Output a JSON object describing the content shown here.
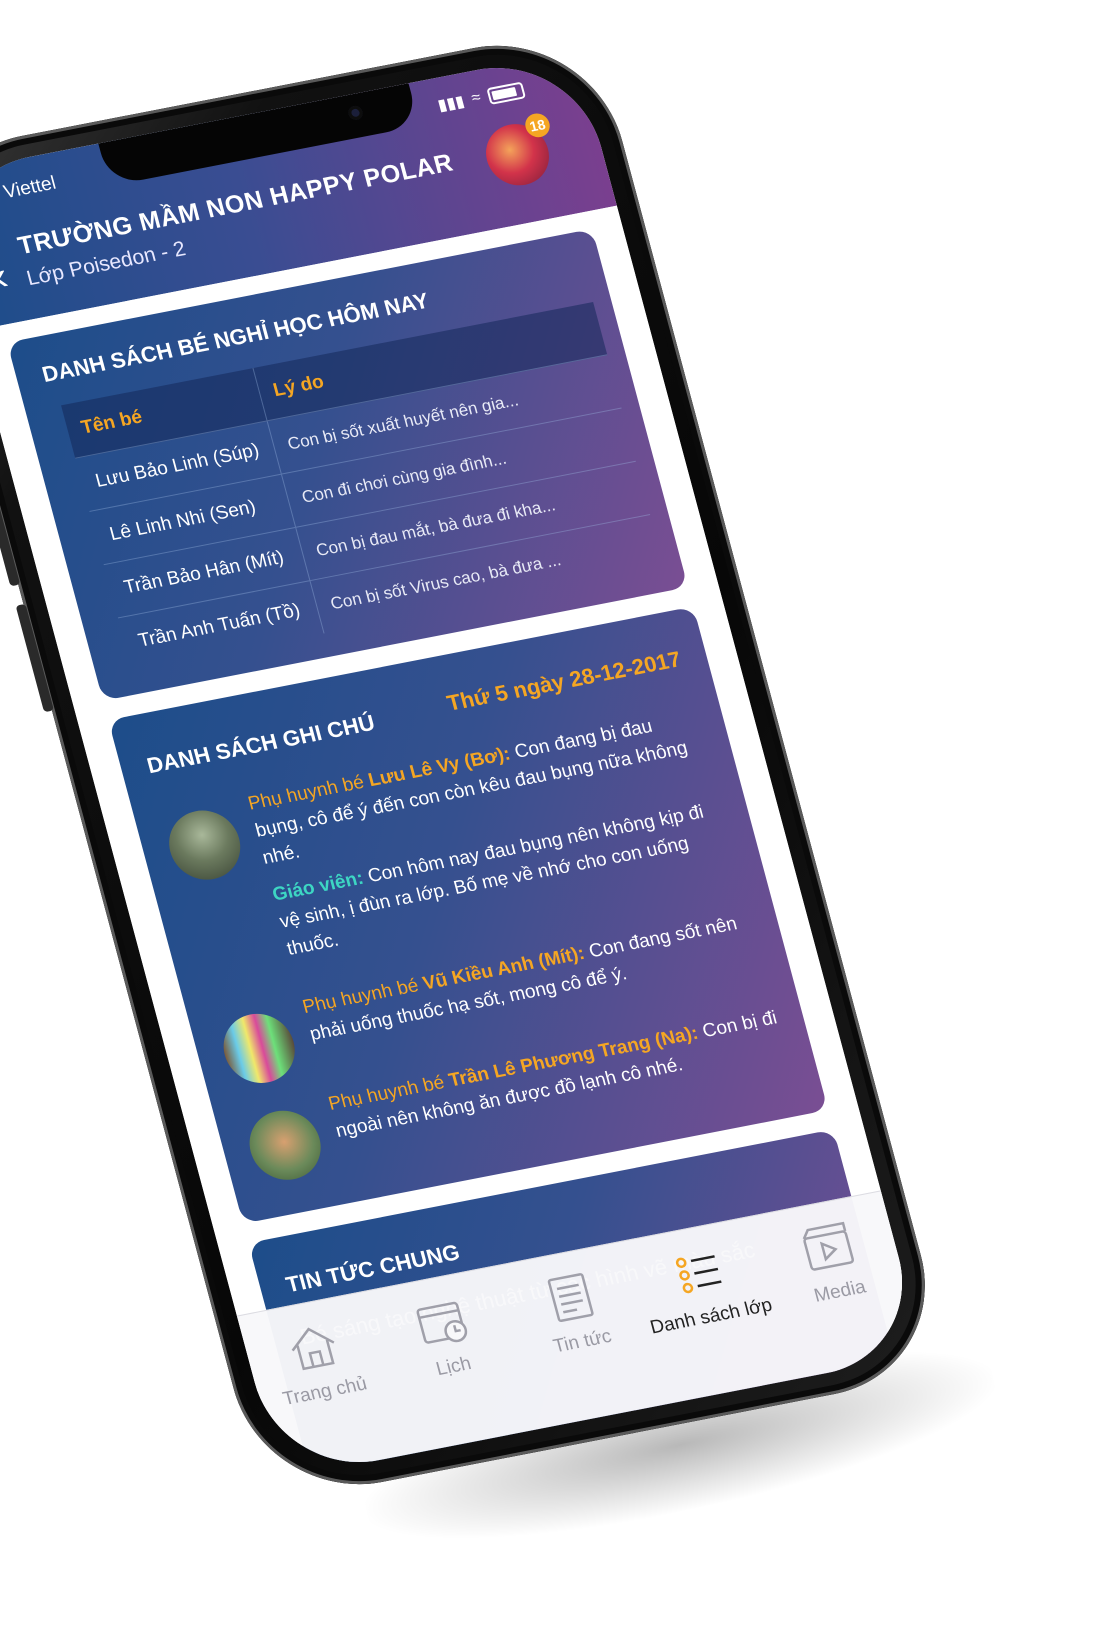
{
  "status_bar": {
    "carrier": "Viettel"
  },
  "header": {
    "school_name": "TRƯỜNG MẦM NON HAPPY POLAR",
    "class_name": "Lớp Poisedon - 2",
    "notification_count": "18"
  },
  "absent_list": {
    "title": "DANH SÁCH BÉ NGHỈ HỌC HÔM NAY",
    "columns": [
      "Tên bé",
      "Lý do"
    ],
    "rows": [
      {
        "name": "Lưu Bảo Linh (Súp)",
        "reason": "Con bị sốt xuất huyết nên gia..."
      },
      {
        "name": "Lê Linh Nhi (Sen)",
        "reason": "Con đi chơi cùng gia đình..."
      },
      {
        "name": "Trần Bảo Hân (Mít)",
        "reason": "Con bị đau mắt, bà đưa đi kha..."
      },
      {
        "name": "Trần Anh Tuấn (Tồ)",
        "reason": "Con bị sốt Virus cao, bà đưa ..."
      }
    ]
  },
  "notes": {
    "title": "DANH SÁCH GHI CHÚ",
    "date": "Thứ 5 ngày 28-12-2017",
    "items": [
      {
        "prefix": "Phụ huynh bé ",
        "child": "Lưu Lê Vy (Bơ):",
        "text": " Con đang bị đau bụng, cô để ý đến con còn kêu đau bụng nữa không nhé.",
        "reply_label": "Giáo viên:",
        "reply_text": " Con hôm nay đau bụng nên không kịp đi vệ sinh, ị đùn ra lớp. Bố mẹ về nhớ cho con uống thuốc."
      },
      {
        "prefix": "Phụ huynh bé ",
        "child": "Vũ Kiều Anh (Mít):",
        "text": " Con đang sốt nên phải uống thuốc hạ sốt, mong cô để ý."
      },
      {
        "prefix": "Phụ huynh bé ",
        "child": "Trần Lê Phương Trang (Na):",
        "text": " Con bị đi ngoài nên không ăn được đồ lạnh cô nhé."
      }
    ]
  },
  "news": {
    "title": "TIN TỨC CHUNG",
    "body": "Bé sáng tạo nghệ thuật từ các hình vẽ màu sắc"
  },
  "tabbar": {
    "items": [
      {
        "label": "Trang chủ",
        "icon": "home-icon"
      },
      {
        "label": "Lịch",
        "icon": "calendar-icon"
      },
      {
        "label": "Tin tức",
        "icon": "news-icon"
      },
      {
        "label": "Danh sách lớp",
        "icon": "list-icon"
      },
      {
        "label": "Media",
        "icon": "media-icon"
      }
    ],
    "active_index": 3,
    "active_color": "#f5a623"
  },
  "colors": {
    "accent": "#f5a623",
    "teacher": "#3dd6c3",
    "gradient_start": "#1d4d8a",
    "gradient_end": "#7a4e93"
  }
}
